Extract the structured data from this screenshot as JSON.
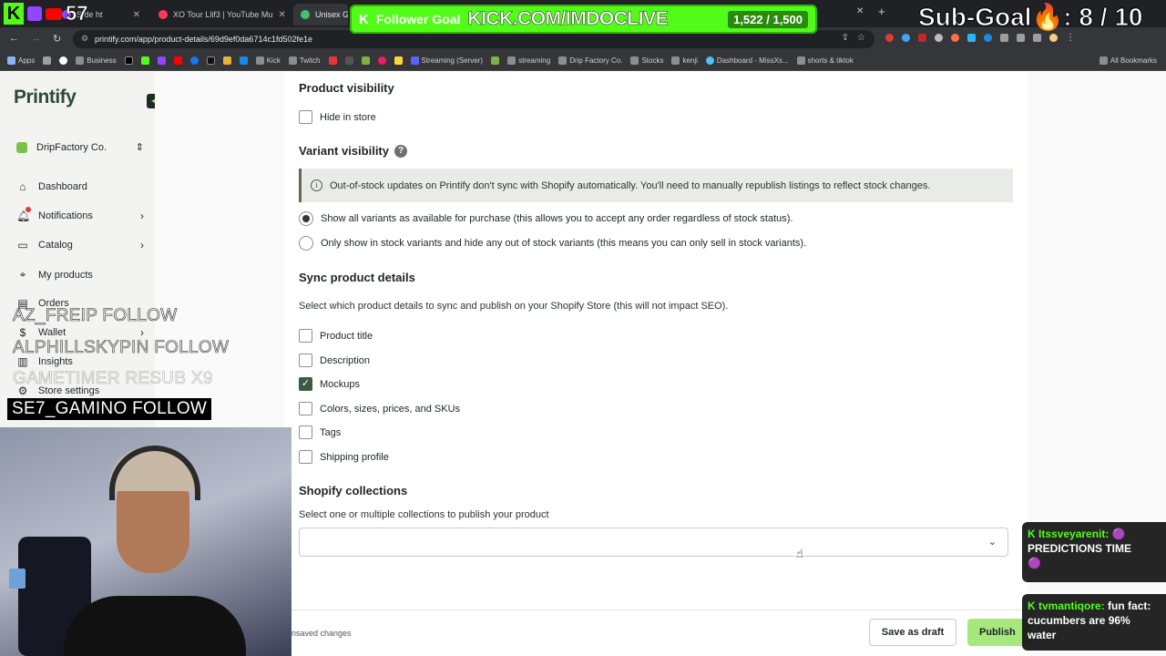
{
  "browser": {
    "tabs": [
      {
        "label": "S   de ht"
      },
      {
        "label": "XO Tour Llif3 | YouTube Mu"
      },
      {
        "label": "Unisex Gar"
      }
    ],
    "url": "printify.com/app/product-details/69d9ef0da6714c1fd502fe1e",
    "bookmarks": [
      "Apps",
      "Business",
      "Kick",
      "Twitch",
      "Streaming (Server)",
      "streaming",
      "Drip Factory Co.",
      "Stocks",
      "kenji",
      "Dashboard - MissXs...",
      "shorts & tiktok",
      "All Bookmarks"
    ]
  },
  "sidebar": {
    "logo": "Printify",
    "store_name": "DripFactory Co.",
    "items": [
      {
        "label": "Dashboard",
        "icon": "home-icon"
      },
      {
        "label": "Notifications",
        "icon": "bell-icon"
      },
      {
        "label": "Catalog",
        "icon": "catalog-icon"
      },
      {
        "label": "My products",
        "icon": "tag-icon"
      },
      {
        "label": "Orders",
        "icon": "orders-icon"
      },
      {
        "label": "Wallet",
        "icon": "dollar-icon"
      },
      {
        "label": "Insights",
        "icon": "chart-icon"
      },
      {
        "label": "Store settings",
        "icon": "settings-icon"
      }
    ]
  },
  "main": {
    "product_visibility": {
      "title": "Product visibility",
      "hide_in_store": "Hide in store"
    },
    "variant_visibility": {
      "title": "Variant visibility",
      "help": "?",
      "info": "Out-of-stock updates on Printify don't sync with Shopify automatically. You'll need to manually republish listings to reflect stock changes.",
      "option_all": "Show all variants as available for purchase (this allows you to accept any order regardless of stock status).",
      "option_instock": "Only show in stock variants and hide any out of stock variants (this means you can only sell in stock variants)."
    },
    "sync": {
      "title": "Sync product details",
      "desc": "Select which product details to sync and publish on your Shopify Store (this will not impact SEO).",
      "items": [
        {
          "label": "Product title",
          "checked": false
        },
        {
          "label": "Description",
          "checked": false
        },
        {
          "label": "Mockups",
          "checked": true
        },
        {
          "label": "Colors, sizes, prices, and SKUs",
          "checked": false
        },
        {
          "label": "Tags",
          "checked": false
        },
        {
          "label": "Shipping profile",
          "checked": false
        }
      ]
    },
    "collections": {
      "title": "Shopify collections",
      "desc": "Select one or multiple collections to publish your product"
    }
  },
  "footer": {
    "unsaved": "nsaved changes",
    "save_draft": "Save as draft",
    "publish": "Publish"
  },
  "overlay": {
    "viewer_count": "57",
    "follower_goal_label": "Follower Goal",
    "follower_goal_url": "KICK.COM/IMDOCLIVE",
    "follower_goal_count": "1,522 / 1,500",
    "sub_goal": "Sub-Goal🔥: 8 / 10",
    "events": [
      {
        "text": "AZ_FREIP  FOLLOW"
      },
      {
        "text": "ALPHILLSKYPIN  FOLLOW"
      },
      {
        "text": "GAMETIMER  RESUB X9"
      },
      {
        "text": "SE7_GAMINO  FOLLOW"
      }
    ],
    "chat": [
      {
        "user": "Itssveyarenit:",
        "message": "PREDICTIONS TIME"
      },
      {
        "user": "tvmantiqore:",
        "message": "fun fact: cucumbers are 96% water"
      }
    ]
  },
  "colors": {
    "kick_green": "#53fc18",
    "publish_green": "#a6e87c",
    "checkbox_on": "#3d5a44"
  }
}
